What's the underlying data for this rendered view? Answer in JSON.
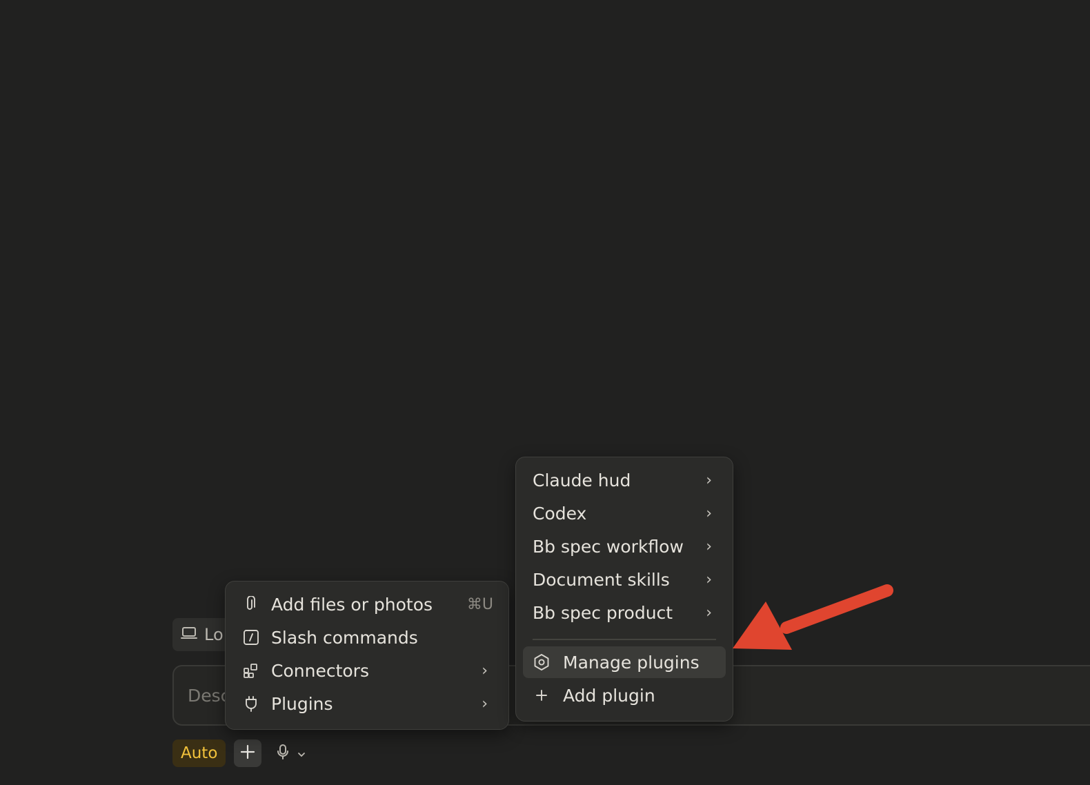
{
  "composer": {
    "location_label": "Lo",
    "prompt_placeholder": "Describe a task",
    "mode_badge": "Auto"
  },
  "main_menu": {
    "items": [
      {
        "label": "Add files or photos",
        "shortcut": "⌘U",
        "icon": "paperclip-icon"
      },
      {
        "label": "Slash commands",
        "icon": "slash-command-icon"
      },
      {
        "label": "Connectors",
        "icon": "connectors-icon",
        "has_submenu": true
      },
      {
        "label": "Plugins",
        "icon": "plug-icon",
        "has_submenu": true
      }
    ]
  },
  "plugins_menu": {
    "plugins": [
      {
        "label": "Claude hud"
      },
      {
        "label": "Codex"
      },
      {
        "label": "Bb spec workflow"
      },
      {
        "label": "Document skills"
      },
      {
        "label": "Bb spec product"
      }
    ],
    "manage_label": "Manage plugins",
    "add_label": "Add plugin",
    "chevron": "›"
  },
  "colors": {
    "background": "#212120",
    "menu_bg": "#2b2b29",
    "highlight": "#3b3b38",
    "auto_badge_text": "#f2c23b",
    "annotation_arrow": "#e0452f"
  }
}
